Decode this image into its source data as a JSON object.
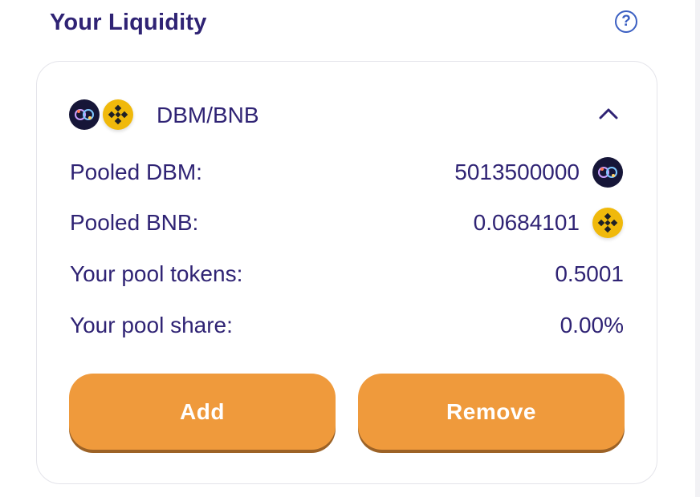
{
  "header": {
    "title": "Your Liquidity",
    "help_icon": "question-circle-icon"
  },
  "pair": {
    "name": "DBM/BNB",
    "expanded": true,
    "token_a_icon": "dbm-token-icon",
    "token_b_icon": "bnb-token-icon"
  },
  "rows": [
    {
      "label": "Pooled DBM:",
      "value": "5013500000",
      "icon": "dbm-token-icon"
    },
    {
      "label": "Pooled BNB:",
      "value": "0.0684101",
      "icon": "bnb-token-icon"
    },
    {
      "label": "Your pool tokens:",
      "value": "0.5001"
    },
    {
      "label": "Your pool share:",
      "value": "0.00%"
    }
  ],
  "actions": {
    "add_label": "Add",
    "remove_label": "Remove"
  },
  "colors": {
    "text": "#2f2374",
    "button": "#ef9a3c",
    "button_shadow": "#9c6226",
    "bnb": "#f0b90b",
    "dbm": "#161638"
  }
}
